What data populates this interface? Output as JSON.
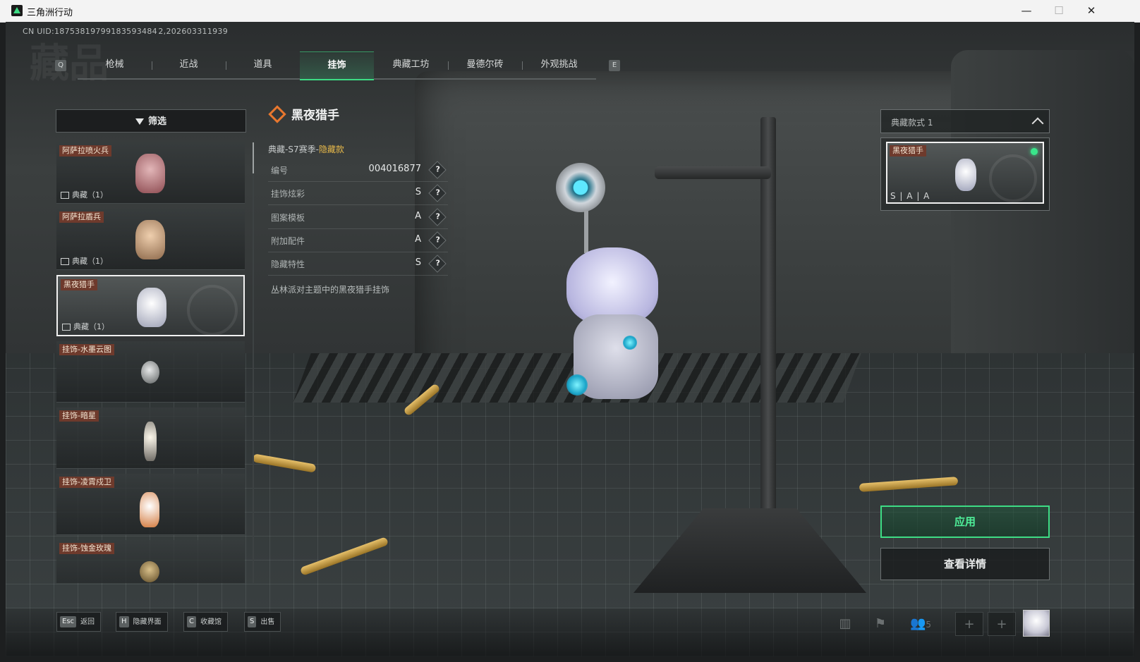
{
  "window": {
    "title": "三角洲行动",
    "minimize": "—",
    "maximize": "☐",
    "close": "✕"
  },
  "uid": "CN UID:18753819799183593484 2,202603311939",
  "tabs": {
    "prev_key": "Q",
    "next_key": "E",
    "items": [
      {
        "label": "枪械"
      },
      {
        "label": "近战"
      },
      {
        "label": "道具"
      },
      {
        "label": "挂饰"
      },
      {
        "label": "典藏工坊"
      },
      {
        "label": "曼德尔砖"
      },
      {
        "label": "外观挑战"
      }
    ],
    "active_index": 3
  },
  "filter": {
    "label": "筛选"
  },
  "items": [
    {
      "name": "阿萨拉喷火兵",
      "count": "典藏（1）",
      "thumb_color": "#c48a8e"
    },
    {
      "name": "阿萨拉盾兵",
      "count": "典藏（1）",
      "thumb_color": "#c9a58a"
    },
    {
      "name": "黑夜猎手",
      "count": "典藏（1）",
      "thumb_color": "#e9e9f2"
    },
    {
      "name": "挂饰-水墨云图",
      "count": "",
      "thumb_color": "#bfc2c4"
    },
    {
      "name": "挂饰-暗星",
      "count": "",
      "thumb_color": "#e8e2d6"
    },
    {
      "name": "挂饰-凌霄戍卫",
      "count": "",
      "thumb_color": "#f1e3d3"
    },
    {
      "name": "挂饰-蚀金玫瑰",
      "count": "",
      "thumb_color": "#b89a66"
    }
  ],
  "selected_item_index": 2,
  "detail": {
    "title": "黑夜猎手",
    "subtitle_prefix": "典藏-S7赛季-",
    "subtitle_hidden": "隐藏款",
    "rows": [
      {
        "key": "编号",
        "value": "004016877"
      },
      {
        "key": "挂饰炫彩",
        "value": "S"
      },
      {
        "key": "图案模板",
        "value": "A"
      },
      {
        "key": "附加配件",
        "value": "A"
      },
      {
        "key": "隐藏特性",
        "value": "S"
      }
    ],
    "help_glyph": "?",
    "description": "丛林派对主题中的黑夜猎手挂饰"
  },
  "variant": {
    "select_label": "典藏款式 1",
    "card_name": "黑夜猎手",
    "card_grade": "S | A | A",
    "selected": true
  },
  "buttons": {
    "apply": "应用",
    "view_details": "查看详情"
  },
  "bottom_hints": [
    {
      "key": "Esc",
      "label": "返回"
    },
    {
      "key": "H",
      "label": "隐藏界面"
    },
    {
      "key": "C",
      "label": "收藏馆"
    },
    {
      "key": "S",
      "label": "出售"
    }
  ],
  "bottom_right": {
    "squad_count": "5",
    "plus": "+"
  },
  "colors": {
    "accent_green": "#3ddc84",
    "tag_brown": "#6e3a2c",
    "hidden_gold": "#e6b84a",
    "title_icon_orange": "#e8772e"
  }
}
